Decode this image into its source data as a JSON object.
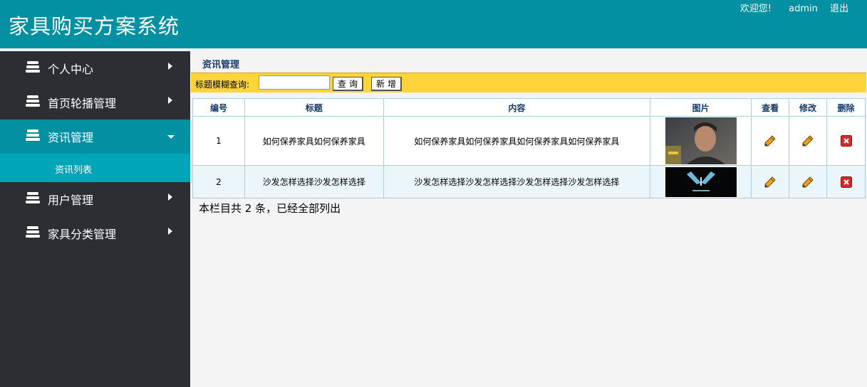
{
  "header": {
    "app_title": "家具购买方案系统",
    "welcome": "欢迎您!",
    "username": "admin",
    "logout": "退出"
  },
  "sidebar": {
    "items": [
      {
        "label": "个人中心"
      },
      {
        "label": "首页轮播管理"
      },
      {
        "label": "资讯管理"
      },
      {
        "label": "用户管理"
      },
      {
        "label": "家具分类管理"
      }
    ],
    "submenu": {
      "label": "资讯列表"
    }
  },
  "main": {
    "section_title": "资讯管理",
    "search": {
      "label": "标题模糊查询:",
      "value": "",
      "query_button": "查询",
      "add_button": "新增"
    },
    "table": {
      "headers": [
        "编号",
        "标题",
        "内容",
        "图片",
        "查看",
        "修改",
        "删除"
      ],
      "rows": [
        {
          "id": "1",
          "title": "如何保养家具如何保养家具",
          "content": "如何保养家具如何保养家具如何保养家具如何保养家具"
        },
        {
          "id": "2",
          "title": "沙发怎样选择沙发怎样选择",
          "content": "沙发怎样选择沙发怎样选择沙发怎样选择沙发怎样选择"
        }
      ]
    },
    "footer_note": "本栏目共 2 条，已经全部列出"
  },
  "icons": {
    "menu": "stack-icon",
    "expand": "caret-right-icon",
    "collapse": "caret-down-icon",
    "view": "pencil-icon",
    "edit": "pencil-icon",
    "delete": "delete-icon"
  },
  "colors": {
    "header_bg": "#0390a3",
    "sidebar_bg": "#2d2e34",
    "active_bg": "#0390a3",
    "submenu_bg": "#00a6b8",
    "search_bar_bg": "#fdd53a",
    "delete_red": "#d32a2a"
  }
}
